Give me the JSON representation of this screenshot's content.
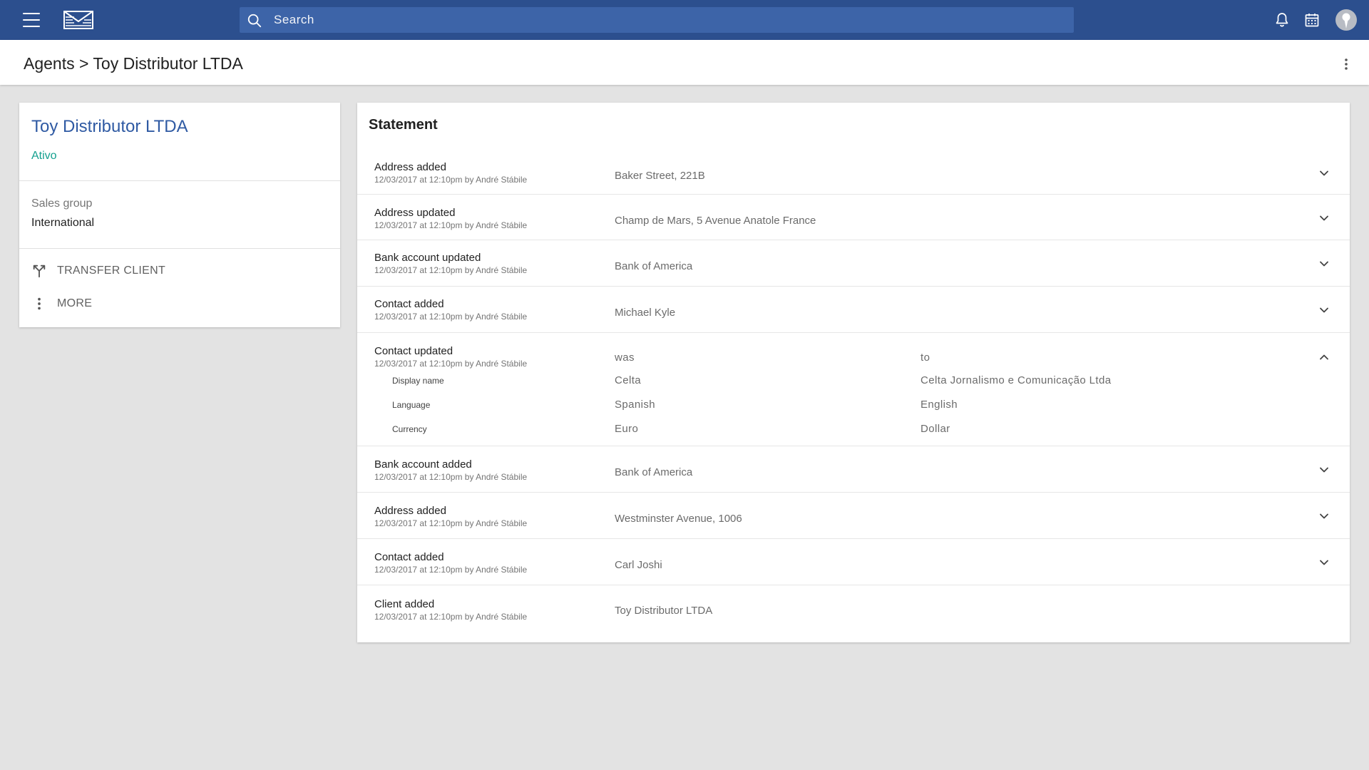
{
  "topbar": {
    "search_placeholder": "Search",
    "icons": [
      "menu-icon",
      "app-logo",
      "search-icon",
      "bell-icon",
      "calendar-icon",
      "avatar"
    ],
    "colors": {
      "bar": "#2c4f8e",
      "search_bg": "#3d64a8"
    }
  },
  "breadcrumb": {
    "parent": "Agents",
    "separator": ">",
    "current": "Toy Distributor LTDA"
  },
  "client": {
    "name": "Toy Distributor LTDA",
    "status": "Ativo",
    "sales_group_label": "Sales group",
    "sales_group_value": "International",
    "actions": [
      {
        "label": "TRANSFER CLIENT",
        "icon": "transfer-icon"
      },
      {
        "label": "MORE",
        "icon": "more-vert-icon"
      }
    ],
    "colors": {
      "name": "#2f5aa3",
      "status": "#14a08f"
    }
  },
  "statement": {
    "title": "Statement",
    "events": [
      {
        "title": "Address added",
        "meta": "12/03/2017 at 12:10pm by André Stábile",
        "value": "Baker Street, 221B",
        "chevron": "down"
      },
      {
        "title": "Address updated",
        "meta": "12/03/2017 at 12:10pm by André Stábile",
        "value": "Champ de Mars, 5 Avenue Anatole France",
        "chevron": "down"
      },
      {
        "title": "Bank account updated",
        "meta": "12/03/2017 at 12:10pm by André Stábile",
        "value": "Bank of America",
        "chevron": "down"
      },
      {
        "title": "Contact added",
        "meta": "12/03/2017 at 12:10pm by André Stábile",
        "value": "Michael Kyle",
        "chevron": "down"
      },
      {
        "title": "Contact updated",
        "meta": "12/03/2017 at 12:10pm by André Stábile",
        "chevron": "up",
        "was_label": "was",
        "to_label": "to",
        "changes": [
          {
            "field": "Display name",
            "was": "Celta",
            "to": "Celta Jornalismo e Comunicação Ltda"
          },
          {
            "field": "Language",
            "was": "Spanish",
            "to": "English"
          },
          {
            "field": "Currency",
            "was": "Euro",
            "to": "Dollar"
          }
        ]
      },
      {
        "title": "Bank account added",
        "meta": "12/03/2017 at 12:10pm by André Stábile",
        "value": "Bank of America",
        "chevron": "down"
      },
      {
        "title": "Address added",
        "meta": "12/03/2017 at 12:10pm by André Stábile",
        "value": "Westminster Avenue, 1006",
        "chevron": "down"
      },
      {
        "title": "Contact added",
        "meta": "12/03/2017 at 12:10pm by André Stábile",
        "value": "Carl Joshi",
        "chevron": "down"
      },
      {
        "title": "Client added",
        "meta": "12/03/2017 at 12:10pm by André Stábile",
        "value": "Toy Distributor LTDA",
        "chevron": "none"
      }
    ]
  }
}
